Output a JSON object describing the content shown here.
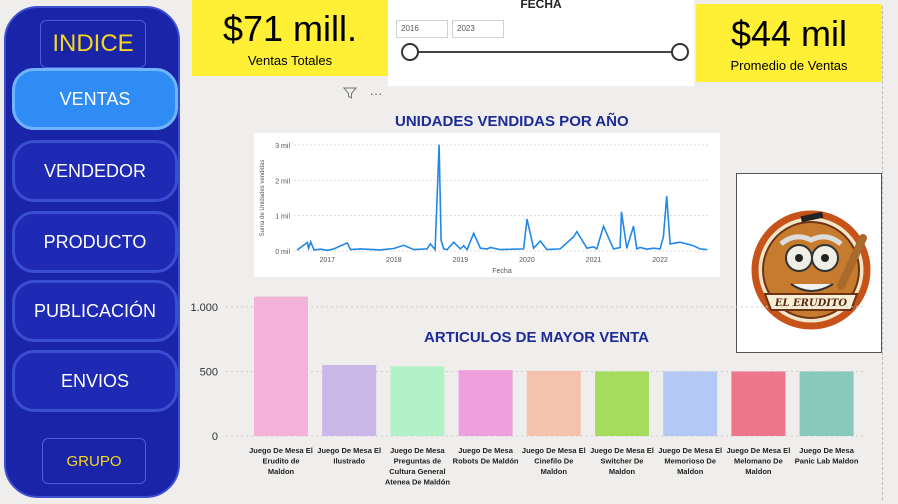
{
  "sidebar": {
    "title": "INDICE",
    "items": [
      {
        "label": "VENTAS",
        "active": true
      },
      {
        "label": "VENDEDOR",
        "active": false
      },
      {
        "label": "PRODUCTO",
        "active": false
      },
      {
        "label": "PUBLICACIÓN",
        "active": false
      },
      {
        "label": "ENVIOS",
        "active": false
      }
    ],
    "group_label": "GRUPO"
  },
  "kpis": {
    "total_sales": {
      "value": "$71 mill.",
      "label": "Ventas Totales"
    },
    "avg_sales": {
      "value": "$44 mil",
      "label": "Promedio de Ventas"
    }
  },
  "slicer": {
    "title": "FECHA",
    "start": "2016",
    "end": "2023"
  },
  "toolbar": {
    "filter_icon": "filter-icon",
    "more_icon": "more-options-icon"
  },
  "line_chart_title": "UNIDADES VENDIDAS POR AÑO",
  "bar_chart_title": "ARTICULOS DE MAYOR VENTA",
  "logo_text": "EL ERUDITO",
  "colors": {
    "sidebar_bg": "#1a24a8",
    "active_button": "#2f8cf5",
    "kpi_bg": "#fff035",
    "title_blue": "#1e2a96",
    "accent_yellow": "#f5d61d",
    "line_color": "#2188e6"
  },
  "chart_data": [
    {
      "type": "line",
      "xlabel": "Fecha",
      "ylabel": "Suma de Unidades vendidas",
      "x_ticks": [
        "2017",
        "2018",
        "2019",
        "2020",
        "2021",
        "2022"
      ],
      "y_ticks": [
        "0 mil",
        "1 mil",
        "2 mil",
        "3 mil"
      ],
      "ylim": [
        0,
        3000
      ],
      "xlim": [
        2016.5,
        2022.75
      ],
      "x": [
        2016.55,
        2016.7,
        2016.72,
        2016.75,
        2016.8,
        2016.9,
        2017.0,
        2017.1,
        2017.3,
        2017.35,
        2017.5,
        2017.8,
        2017.9,
        2018.0,
        2018.15,
        2018.3,
        2018.5,
        2018.55,
        2018.62,
        2018.68,
        2018.71,
        2018.75,
        2018.8,
        2018.9,
        2019.0,
        2019.05,
        2019.1,
        2019.2,
        2019.3,
        2019.4,
        2019.45,
        2019.6,
        2019.8,
        2019.95,
        2020.0,
        2020.1,
        2020.2,
        2020.3,
        2020.5,
        2020.7,
        2020.75,
        2020.9,
        2021.0,
        2021.05,
        2021.15,
        2021.3,
        2021.4,
        2021.42,
        2021.5,
        2021.6,
        2021.65,
        2021.7,
        2021.8,
        2021.9,
        2022.0,
        2022.05,
        2022.1,
        2022.15,
        2022.3,
        2022.4,
        2022.5,
        2022.6,
        2022.7
      ],
      "y": [
        30,
        240,
        80,
        260,
        30,
        50,
        20,
        60,
        230,
        40,
        60,
        30,
        50,
        70,
        160,
        40,
        60,
        200,
        40,
        3000,
        300,
        60,
        40,
        250,
        60,
        150,
        40,
        500,
        80,
        60,
        100,
        40,
        50,
        60,
        900,
        80,
        280,
        40,
        60,
        400,
        550,
        80,
        120,
        60,
        700,
        60,
        100,
        1100,
        80,
        700,
        60,
        100,
        50,
        80,
        60,
        400,
        1550,
        200,
        250,
        200,
        150,
        60,
        40
      ]
    },
    {
      "type": "bar",
      "categories": [
        "Juego De Mesa El Erudito de Maldon",
        "Juego De Mesa El Ilustrado",
        "Juego De Mesa Preguntas de Cultura General Atenea De Maldón",
        "Juego De Mesa Robots De Maldón",
        "Juego De Mesa El Cinefilo De Maldon",
        "Juego De Mesa El Switcher De Maldon",
        "Juego De Mesa El Memorioso De Maldon",
        "Juego De Mesa El Melomano De Maldon",
        "Juego De Mesa Panic Lab Maldon"
      ],
      "values": [
        1080,
        550,
        540,
        510,
        505,
        500,
        500,
        500,
        500
      ],
      "colors": [
        "#f3b3d9",
        "#c9b7e8",
        "#b2f2c6",
        "#ee9fdc",
        "#f5c3ad",
        "#a6dc5e",
        "#b3c8f4",
        "#ec778b",
        "#87c9ba"
      ],
      "y_ticks": [
        "0",
        "500",
        "1.000"
      ],
      "ylim": [
        0,
        1100
      ]
    }
  ]
}
